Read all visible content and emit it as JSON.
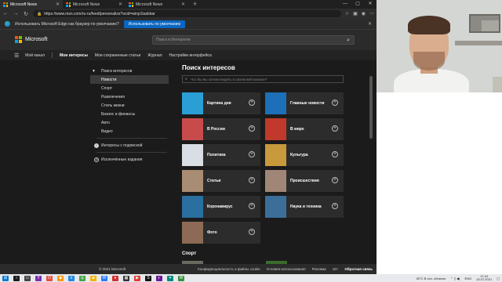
{
  "tabs": [
    {
      "label": "Microsoft News",
      "active": true
    },
    {
      "label": "Microsoft News",
      "active": false
    },
    {
      "label": "Microsoft News",
      "active": false
    }
  ],
  "address": {
    "url": "https://www.msn.com/ru-ru/feed/personalize?ocid=winp1taskbar"
  },
  "infobar": {
    "text": "Использовать Microsoft Edge как браузер по умолчанию?",
    "button": "Использовать по умолчанию"
  },
  "msn": {
    "brand": "Microsoft",
    "search_placeholder": "Поиск в Интернете",
    "nav": [
      "Мой канал",
      "Мои интересы",
      "Мои сохраненные статьи",
      "Журнал",
      "Настройки интерфейса"
    ]
  },
  "sidebar": {
    "items": [
      {
        "label": "Поиск интересов",
        "kind": "head"
      },
      {
        "label": "Новости",
        "kind": "active"
      },
      {
        "label": "Спорт",
        "kind": "item"
      },
      {
        "label": "Развлечения",
        "kind": "item"
      },
      {
        "label": "Стиль жизни",
        "kind": "item"
      },
      {
        "label": "Бизнес и финансы",
        "kind": "item"
      },
      {
        "label": "Авто",
        "kind": "item"
      },
      {
        "label": "Видео",
        "kind": "item"
      }
    ],
    "followed": "Интересы с подпиской",
    "excluded": "Исключённые издания"
  },
  "main": {
    "title": "Поиск интересов",
    "search_placeholder": "Что бы вы хотели видеть в своем веб-канале?",
    "cards": [
      {
        "label": "Картина дня",
        "color": "#2a9fd6"
      },
      {
        "label": "Главные новости",
        "color": "#1d6fb8"
      },
      {
        "label": "В России",
        "color": "#c84b4b"
      },
      {
        "label": "В мире",
        "color": "#c0392b"
      },
      {
        "label": "Политика",
        "color": "#d9dde4"
      },
      {
        "label": "Культура",
        "color": "#c89a3c"
      },
      {
        "label": "Статьи",
        "color": "#a88c73"
      },
      {
        "label": "Происшествия",
        "color": "#a08676"
      },
      {
        "label": "Коронавирус",
        "color": "#2a6fa0"
      },
      {
        "label": "Наука и техника",
        "color": "#3c6e9a"
      },
      {
        "label": "Фото",
        "color": "#8c6a55"
      }
    ],
    "section2": "Спорт"
  },
  "footer": {
    "copyright": "© 2021 Microsoft",
    "links": [
      "Конфиденциальность и файлы cookie",
      "Условия использования",
      "Реклама",
      "18+"
    ],
    "feedback": "Обратная связь"
  },
  "taskbar": {
    "weather": "30°C  В осн. облачно",
    "lang": "ENG",
    "time": "17:41",
    "date": "13.07.2021"
  }
}
